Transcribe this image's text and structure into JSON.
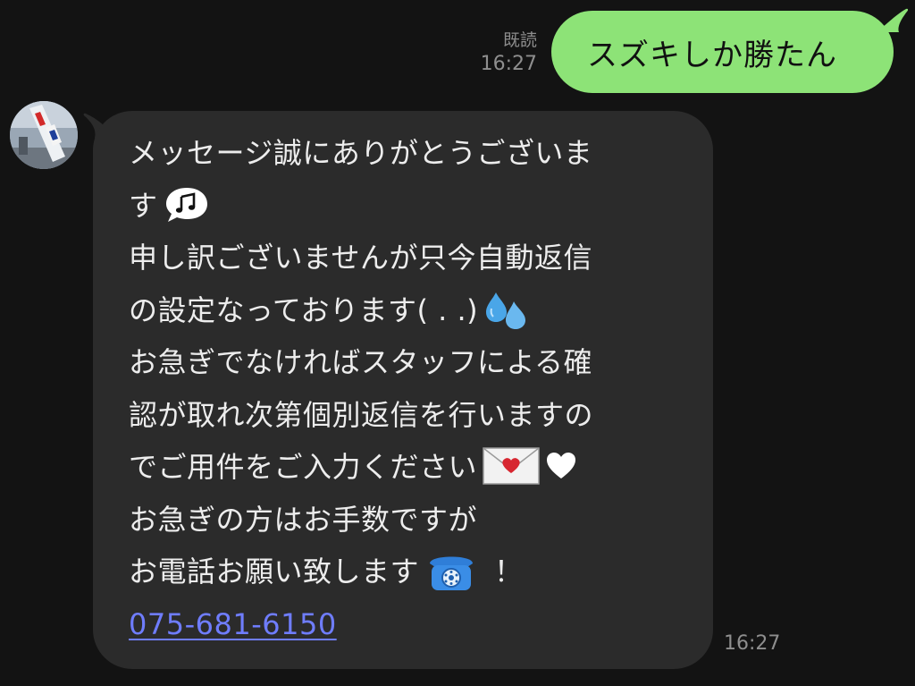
{
  "outgoing": {
    "read_label": "既読",
    "time": "16:27",
    "text": "スズキしか勝たん"
  },
  "incoming": {
    "lines": [
      "メッセージ誠にありがとうございま",
      "す",
      "申し訳ございませんが只今自動返信",
      "の設定なっております( . .)",
      "お急ぎでなければスタッフによる確",
      "認が取れ次第個別返信を行いますの",
      "でご用件をご入力ください",
      "お急ぎの方はお手数ですが",
      "お電話お願い致します",
      "！"
    ],
    "phone_link": "075-681-6150",
    "time": "16:27",
    "emojis": [
      "music-note-bubble",
      "sweat-droplets",
      "love-letter",
      "white-heart",
      "telephone"
    ]
  },
  "colors": {
    "background": "#131313",
    "outgoing_bubble": "#8de377",
    "incoming_bubble": "#2b2b2b",
    "link": "#6f7dff",
    "meta_text": "#8e8e8e"
  }
}
